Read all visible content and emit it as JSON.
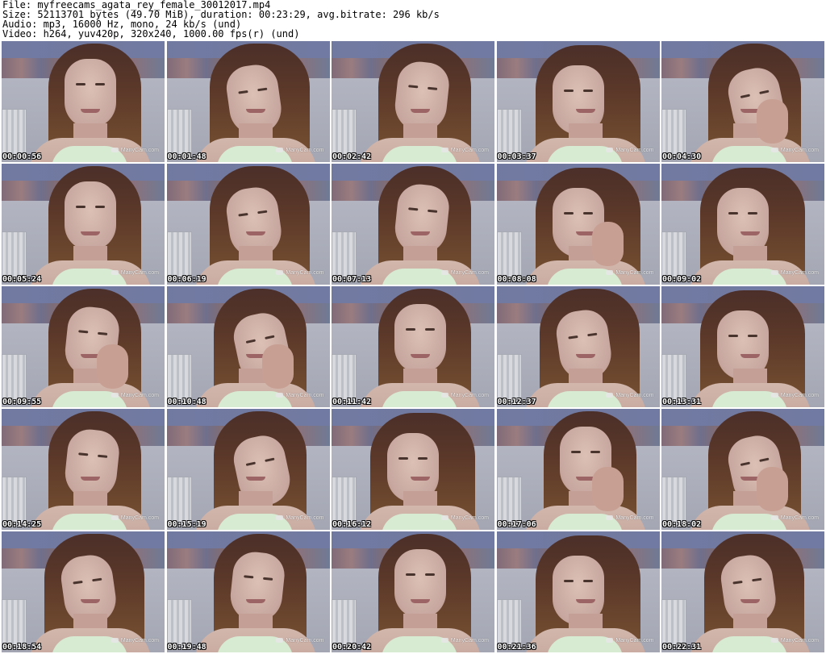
{
  "header": {
    "file": "File: myfreecams_agata_rey_female_30012017.mp4",
    "size": "Size: 52113701 bytes (49.70 MiB), duration: 00:23:29, avg.bitrate: 296 kb/s",
    "audio": "Audio: mp3, 16000 Hz, mono, 24 kb/s (und)",
    "video": "Video: h264, yuv420p, 320x240, 1000.00 fps(r) (und)"
  },
  "thumbnails": [
    {
      "time": "00:00:56",
      "watermark": "ManyCam.com",
      "icon": "manycam-logo-icon"
    },
    {
      "time": "00:01:48",
      "watermark": "ManyCam.com",
      "icon": "manycam-logo-icon"
    },
    {
      "time": "00:02:42",
      "watermark": "ManyCam.com",
      "icon": "manycam-logo-icon"
    },
    {
      "time": "00:03:37",
      "watermark": "ManyCam.com",
      "icon": "manycam-logo-icon"
    },
    {
      "time": "00:04:30",
      "watermark": "ManyCam.com",
      "icon": "manycam-logo-icon"
    },
    {
      "time": "00:05:24",
      "watermark": "ManyCam.com",
      "icon": "manycam-logo-icon"
    },
    {
      "time": "00:06:19",
      "watermark": "ManyCam.com",
      "icon": "manycam-logo-icon"
    },
    {
      "time": "00:07:13",
      "watermark": "ManyCam.com",
      "icon": "manycam-logo-icon"
    },
    {
      "time": "00:08:08",
      "watermark": "ManyCam.com",
      "icon": "manycam-logo-icon"
    },
    {
      "time": "00:09:02",
      "watermark": "ManyCam.com",
      "icon": "manycam-logo-icon"
    },
    {
      "time": "00:09:55",
      "watermark": "ManyCam.com",
      "icon": "manycam-logo-icon"
    },
    {
      "time": "00:10:48",
      "watermark": "ManyCam.com",
      "icon": "manycam-logo-icon"
    },
    {
      "time": "00:11:42",
      "watermark": "ManyCam.com",
      "icon": "manycam-logo-icon"
    },
    {
      "time": "00:12:37",
      "watermark": "ManyCam.com",
      "icon": "manycam-logo-icon"
    },
    {
      "time": "00:13:31",
      "watermark": "ManyCam.com",
      "icon": "manycam-logo-icon"
    },
    {
      "time": "00:14:25",
      "watermark": "ManyCam.com",
      "icon": "manycam-logo-icon"
    },
    {
      "time": "00:15:19",
      "watermark": "ManyCam.com",
      "icon": "manycam-logo-icon"
    },
    {
      "time": "00:16:12",
      "watermark": "ManyCam.com",
      "icon": "manycam-logo-icon"
    },
    {
      "time": "00:17:06",
      "watermark": "ManyCam.com",
      "icon": "manycam-logo-icon"
    },
    {
      "time": "00:18:02",
      "watermark": "ManyCam.com",
      "icon": "manycam-logo-icon"
    },
    {
      "time": "00:18:54",
      "watermark": "ManyCam.com",
      "icon": "manycam-logo-icon"
    },
    {
      "time": "00:19:48",
      "watermark": "ManyCam.com",
      "icon": "manycam-logo-icon"
    },
    {
      "time": "00:20:42",
      "watermark": "ManyCam.com",
      "icon": "manycam-logo-icon"
    },
    {
      "time": "00:21:36",
      "watermark": "ManyCam.com",
      "icon": "manycam-logo-icon"
    },
    {
      "time": "00:22:31",
      "watermark": "ManyCam.com",
      "icon": "manycam-logo-icon"
    }
  ]
}
